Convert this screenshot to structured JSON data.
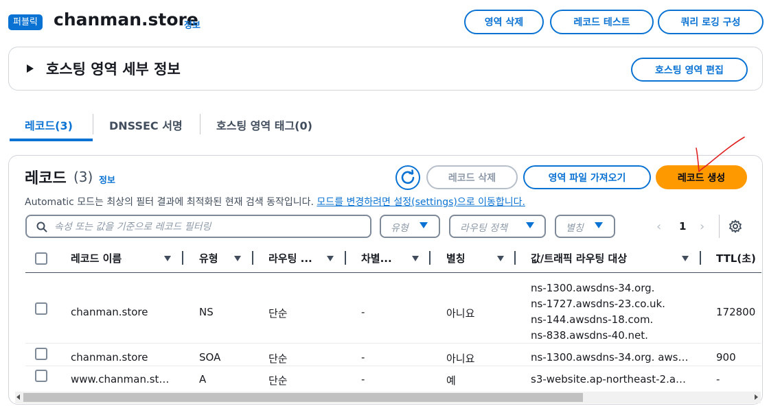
{
  "header": {
    "badge": "퍼블릭",
    "zone_name": "chanman.store",
    "info_link": "정보",
    "buttons": {
      "delete_zone": "영역 삭제",
      "test_record": "레코드 테스트",
      "query_logging": "쿼리 로깅 구성"
    }
  },
  "details_panel": {
    "title": "호스팅 영역 세부 정보",
    "edit_button": "호스팅 영역 편집"
  },
  "tabs": [
    {
      "label": "레코드(3)",
      "active": true
    },
    {
      "label": "DNSSEC 서명",
      "active": false
    },
    {
      "label": "호스팅 영역 태그(0)",
      "active": false
    }
  ],
  "records": {
    "title": "레코드",
    "count": "(3)",
    "info_link": "정보",
    "refresh_icon": "refresh-icon",
    "buttons": {
      "delete": "레코드 삭제",
      "import": "영역 파일 가져오기",
      "create": "레코드 생성"
    },
    "notice_prefix": "Automatic 모드는 최상의 필터 결과에 최적화된 현재 검색 동작입니다. ",
    "notice_link": "모드를 변경하려면 설정(settings)으로 이동합니다.",
    "search_placeholder": "속성 또는 값을 기준으로 레코드 필터링",
    "filters": {
      "type": "유형",
      "routing": "라우팅 정책",
      "alias": "별칭"
    },
    "pagination": {
      "page": "1"
    },
    "columns": [
      "레코드 이름",
      "유형",
      "라우팅 ...",
      "차별...",
      "별칭",
      "값/트래픽 라우팅 대상",
      "TTL(초)"
    ],
    "rows": [
      {
        "name": "chanman.store",
        "type": "NS",
        "routing": "단순",
        "diff": "-",
        "alias": "아니요",
        "value": [
          "ns-1300.awsdns-34.org.",
          "ns-1727.awsdns-23.co.uk.",
          "ns-144.awsdns-18.com.",
          "ns-838.awsdns-40.net."
        ],
        "ttl": "172800"
      },
      {
        "name": "chanman.store",
        "type": "SOA",
        "routing": "단순",
        "diff": "-",
        "alias": "아니요",
        "value": [
          "ns-1300.awsdns-34.org. aws…"
        ],
        "ttl": "900"
      },
      {
        "name": "www.chanman.st…",
        "type": "A",
        "routing": "단순",
        "diff": "-",
        "alias": "예",
        "value": [
          "s3-website.ap-northeast-2.a…"
        ],
        "ttl": "-"
      }
    ]
  },
  "colors": {
    "accent": "#0972d3",
    "primary_button": "#ff9900",
    "annotation": "#e02020"
  }
}
